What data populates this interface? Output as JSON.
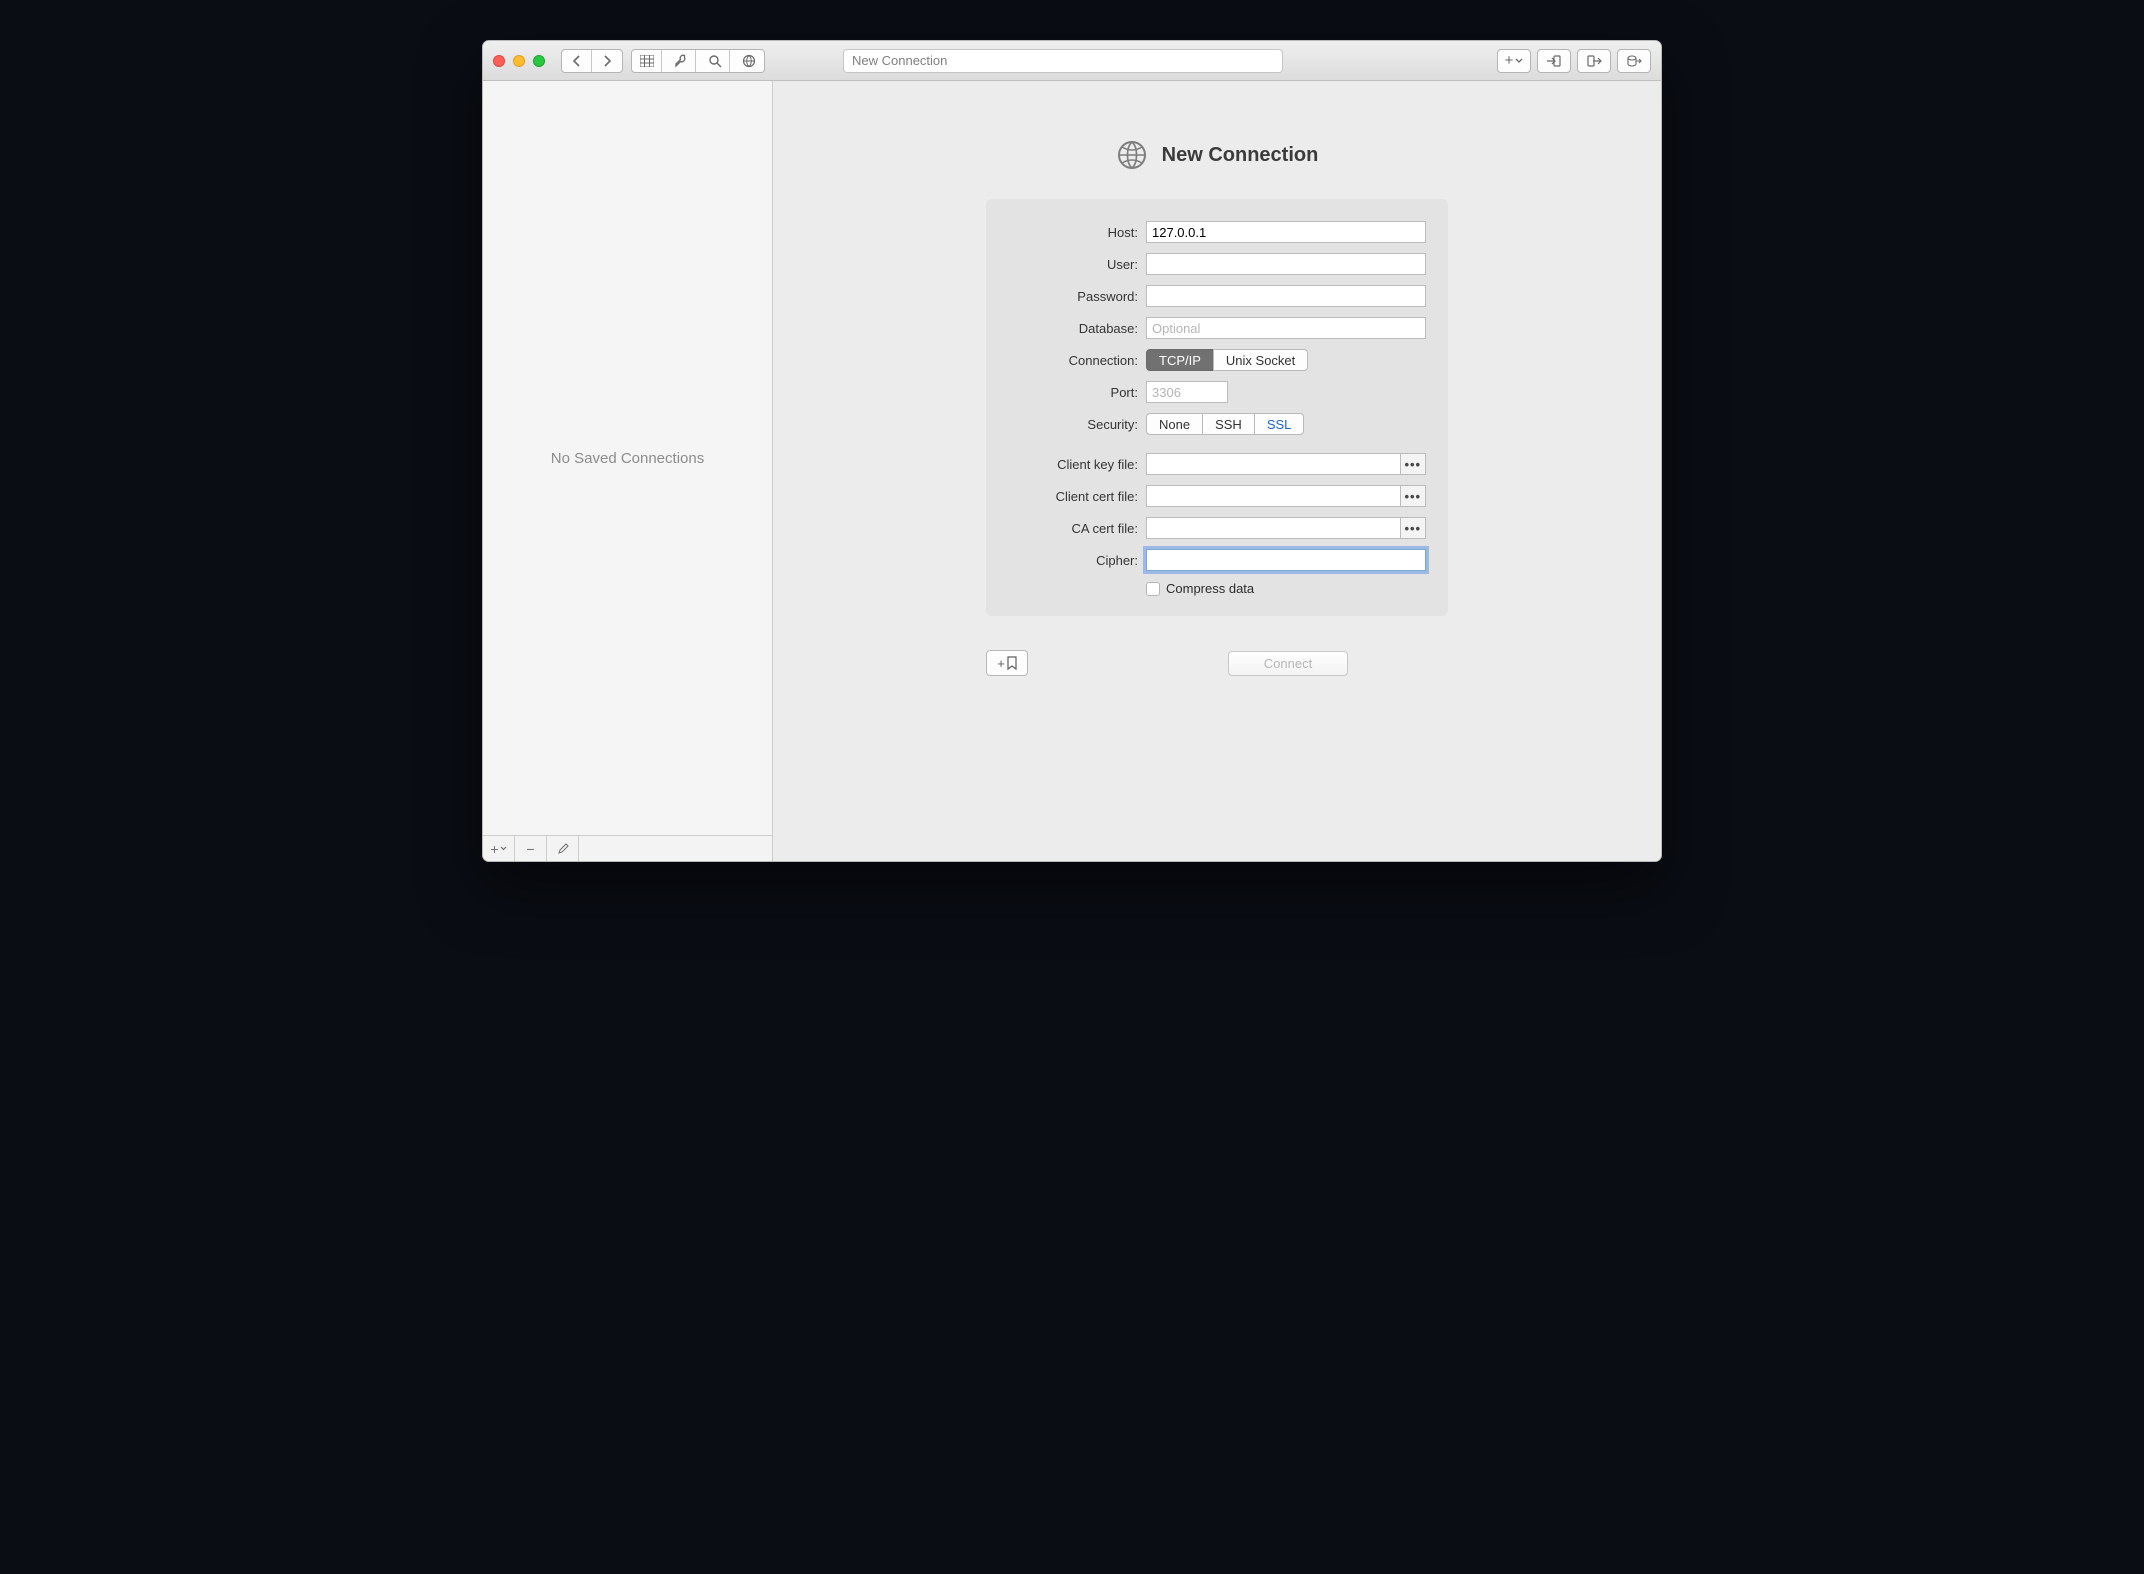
{
  "toolbar": {
    "search_placeholder": "New Connection"
  },
  "sidebar": {
    "empty_text": "No Saved Connections"
  },
  "header": {
    "title": "New Connection"
  },
  "form": {
    "host_label": "Host:",
    "host_value": "127.0.0.1",
    "user_label": "User:",
    "user_value": "",
    "password_label": "Password:",
    "password_value": "",
    "database_label": "Database:",
    "database_placeholder": "Optional",
    "database_value": "",
    "connection_label": "Connection:",
    "connection_options": {
      "tcpip": "TCP/IP",
      "unix": "Unix Socket"
    },
    "port_label": "Port:",
    "port_placeholder": "3306",
    "port_value": "",
    "security_label": "Security:",
    "security_options": {
      "none": "None",
      "ssh": "SSH",
      "ssl": "SSL"
    },
    "client_key_label": "Client key file:",
    "client_cert_label": "Client cert file:",
    "ca_cert_label": "CA cert file:",
    "cipher_label": "Cipher:",
    "cipher_value": "",
    "compress_label": "Compress data"
  },
  "actions": {
    "connect_label": "Connect"
  }
}
